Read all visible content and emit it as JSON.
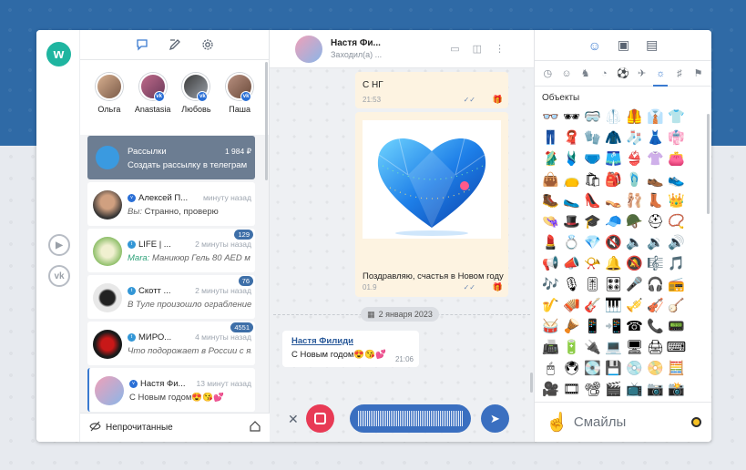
{
  "list_header": {
    "icons": [
      "chat-icon",
      "compose-icon",
      "settings-icon"
    ]
  },
  "stories": [
    {
      "name": "Ольга",
      "color": "#c9a07a"
    },
    {
      "name": "Anastasia",
      "color": "#b05a7a"
    },
    {
      "name": "Любовь",
      "color": "#7a8a9a"
    },
    {
      "name": "Паша",
      "color": "#a08070"
    }
  ],
  "chats": [
    {
      "name": "Рассылки",
      "time": "1 984 ₽",
      "preview": "Создать рассылку в телеграм",
      "color": "#3a9ae0",
      "unread": ""
    },
    {
      "name": "Алексей П...",
      "time": "минуту назад",
      "preview_prefix": "Вы:",
      "preview": "Странно, проверю",
      "color": "#555555",
      "unread": ""
    },
    {
      "name": "LIFE | ...",
      "time": "2 минуты назад",
      "preview_prefix": "Mara:",
      "preview": "Маникюр Гель 80 AED м",
      "color": "#8fbf6a",
      "unread": "129"
    },
    {
      "name": "Скотт ...",
      "time": "2 минуты назад",
      "preview": "В Туле произошло ограбление",
      "color": "#333333",
      "unread": "76"
    },
    {
      "name": "МИРО...",
      "time": "4 минуты назад",
      "preview": "Что подорожает в России с ян",
      "color": "#c81818",
      "unread": "4551"
    },
    {
      "name": "Настя Фи...",
      "time": "13 минут назад",
      "preview": "С Новым годом😍😘💕",
      "color": "#e8a0b0",
      "unread": ""
    }
  ],
  "list_footer": {
    "label": "Непрочитанные"
  },
  "chat_header": {
    "name": "Настя Фи...",
    "status": "Заходил(а) ..."
  },
  "messages": {
    "m1_text": "С НГ",
    "m1_time": "21:53",
    "m2_text": "Поздравляю, счастья в Новом году",
    "m2_time": "01.9",
    "date_separator": "2 января 2023",
    "m3_author": "Настя Филиди",
    "m3_text": "С Новым годом😍😘💕",
    "m3_time": "21:06"
  },
  "emoji_panel": {
    "tabs": [
      "smile-icon",
      "sticker-icon",
      "gif-icon"
    ],
    "category_title": "Объекты",
    "emojis": [
      "👓",
      "🕶",
      "🥽",
      "🥼",
      "🦺",
      "👔",
      "👕",
      "👖",
      "🧣",
      "🧤",
      "🧥",
      "🧦",
      "👗",
      "👘",
      "🥻",
      "🩱",
      "🩲",
      "🩳",
      "👙",
      "👚",
      "👛",
      "👜",
      "👝",
      "🛍",
      "🎒",
      "🩴",
      "👞",
      "👟",
      "🥾",
      "🥿",
      "👠",
      "👡",
      "🩰",
      "👢",
      "👑",
      "👒",
      "🎩",
      "🎓",
      "🧢",
      "🪖",
      "⛑",
      "📿",
      "💄",
      "💍",
      "💎",
      "🔇",
      "🔈",
      "🔉",
      "🔊",
      "📢",
      "📣",
      "📯",
      "🔔",
      "🔕",
      "🎼",
      "🎵",
      "🎶",
      "🎙",
      "🎚",
      "🎛",
      "🎤",
      "🎧",
      "📻",
      "🎷",
      "🪗",
      "🎸",
      "🎹",
      "🎺",
      "🎻",
      "🪕",
      "🥁",
      "🪘",
      "📱",
      "📲",
      "☎",
      "📞",
      "📟",
      "📠",
      "🔋",
      "🔌",
      "💻",
      "🖥",
      "🖨",
      "⌨",
      "🖱",
      "🖲",
      "💽",
      "💾",
      "💿",
      "📀",
      "🧮",
      "🎥",
      "🎞",
      "📽",
      "🎬",
      "📺",
      "📷",
      "📸"
    ],
    "footer_label": "Смайлы"
  }
}
